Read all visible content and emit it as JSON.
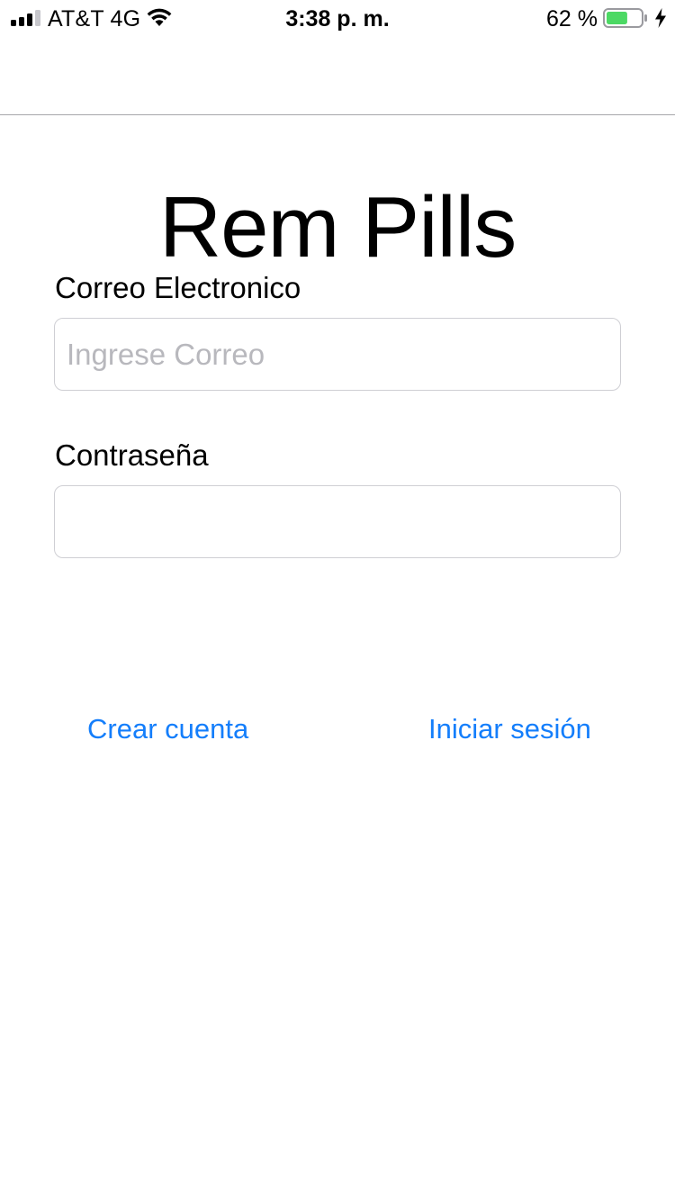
{
  "status_bar": {
    "carrier": "AT&T 4G",
    "time": "3:38 p. m.",
    "battery_percent": "62 %",
    "battery_level": 0.62,
    "battery_color": "#4cd964",
    "signal_icon": "signal-bars-icon",
    "wifi_icon": "wifi-icon",
    "battery_icon": "battery-icon",
    "charging_icon": "charging-bolt-icon"
  },
  "app": {
    "title": "Rem Pills"
  },
  "form": {
    "email_label": "Correo Electronico",
    "email_placeholder": "Ingrese Correo",
    "email_value": "",
    "password_label": "Contraseña",
    "password_value": ""
  },
  "actions": {
    "create_account_label": "Crear cuenta",
    "login_label": "Iniciar sesión"
  },
  "colors": {
    "accent": "#147efb",
    "placeholder": "#b8b8bd",
    "field_border": "#cfcfd4",
    "divider": "#a7a7aa"
  }
}
